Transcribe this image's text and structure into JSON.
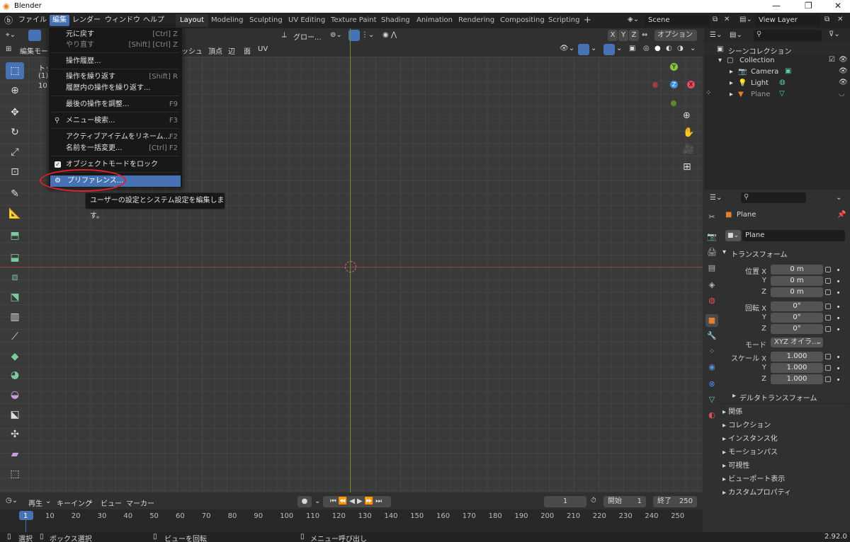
{
  "window": {
    "title": "Blender"
  },
  "menubar": {
    "items": [
      "ファイル",
      "編集",
      "レンダー",
      "ウィンドウ",
      "ヘルプ"
    ],
    "active": "編集"
  },
  "workspaces": [
    "Layout",
    "Modeling",
    "Sculpting",
    "UV Editing",
    "Texture Paint",
    "Shading",
    "Animation",
    "Rendering",
    "Compositing",
    "Scripting"
  ],
  "scene": {
    "name": "Scene",
    "view_layer": "View Layer"
  },
  "viewport_header": {
    "mode": "編集モード",
    "transform": "グロー...",
    "xyz": [
      "X",
      "Y",
      "Z"
    ],
    "options": "オプション",
    "menus": [
      "ッシュ",
      "頂点",
      "辺",
      "面",
      "UV"
    ],
    "overlay_text": [
      "トッ",
      "(1)",
      "10"
    ]
  },
  "edit_menu": {
    "items": [
      {
        "label": "元に戻す",
        "shortcut": "[Ctrl] Z",
        "dim": false
      },
      {
        "label": "やり直す",
        "shortcut": "[Shift] [Ctrl] Z",
        "dim": true
      },
      {
        "label": "操作履歴...",
        "shortcut": "",
        "dim": false
      },
      {
        "label": "操作を繰り返す",
        "shortcut": "[Shift] R",
        "dim": false
      },
      {
        "label": "履歴内の操作を繰り返す...",
        "shortcut": "",
        "dim": false
      },
      {
        "label": "最後の操作を調整...",
        "shortcut": "F9",
        "dim": false
      },
      {
        "label": "メニュー検索...",
        "shortcut": "F3",
        "dim": false
      },
      {
        "label": "アクティブアイテムをリネーム...",
        "shortcut": "F2",
        "dim": false
      },
      {
        "label": "名前を一括変更...",
        "shortcut": "[Ctrl] F2",
        "dim": false
      },
      {
        "label": "オブジェクトモードをロック",
        "shortcut": "",
        "dim": false
      },
      {
        "label": "プリファレンス...",
        "shortcut": "",
        "dim": false
      }
    ],
    "tooltip": "ユーザーの設定とシステム設定を編集します。"
  },
  "outliner": {
    "root": "シーンコレクション",
    "collection": "Collection",
    "objects": [
      "Camera",
      "Light",
      "Plane"
    ]
  },
  "properties": {
    "object_name": "Plane",
    "data_name": "Plane",
    "transform_title": "トランスフォーム",
    "location_label": "位置 X",
    "rotation_label": "回転 X",
    "scale_label": "スケール X",
    "axis_y": "Y",
    "axis_z": "Z",
    "location": [
      "0 m",
      "0 m",
      "0 m"
    ],
    "rotation": [
      "0°",
      "0°",
      "0°"
    ],
    "mode_label": "モード",
    "mode_value": "XYZ オイラ...",
    "scale": [
      "1.000",
      "1.000",
      "1.000"
    ],
    "delta": "デルタトランスフォーム",
    "sections": [
      "関係",
      "コレクション",
      "インスタンス化",
      "モーションパス",
      "可視性",
      "ビューポート表示",
      "カスタムプロパティ"
    ]
  },
  "timeline": {
    "menus": [
      "再生",
      "キーイング",
      "ビュー",
      "マーカー"
    ],
    "current_frame": "1",
    "start_label": "開始",
    "start": "1",
    "end_label": "終了",
    "end": "250",
    "ticks": [
      "1",
      "10",
      "20",
      "30",
      "40",
      "50",
      "60",
      "70",
      "80",
      "90",
      "100",
      "110",
      "120",
      "130",
      "140",
      "150",
      "160",
      "170",
      "180",
      "190",
      "200",
      "210",
      "220",
      "230",
      "240",
      "250"
    ]
  },
  "statusbar": {
    "items": [
      "選択",
      "ボックス選択",
      "ビューを回転",
      "メニュー呼び出し"
    ],
    "version": "2.92.0"
  },
  "colors": {
    "accent": "#4772b3",
    "x_axis": "#e84a5f",
    "y_axis": "#8ac33a",
    "z_axis": "#3d8ee0",
    "highlight_circle": "#e0202a"
  }
}
